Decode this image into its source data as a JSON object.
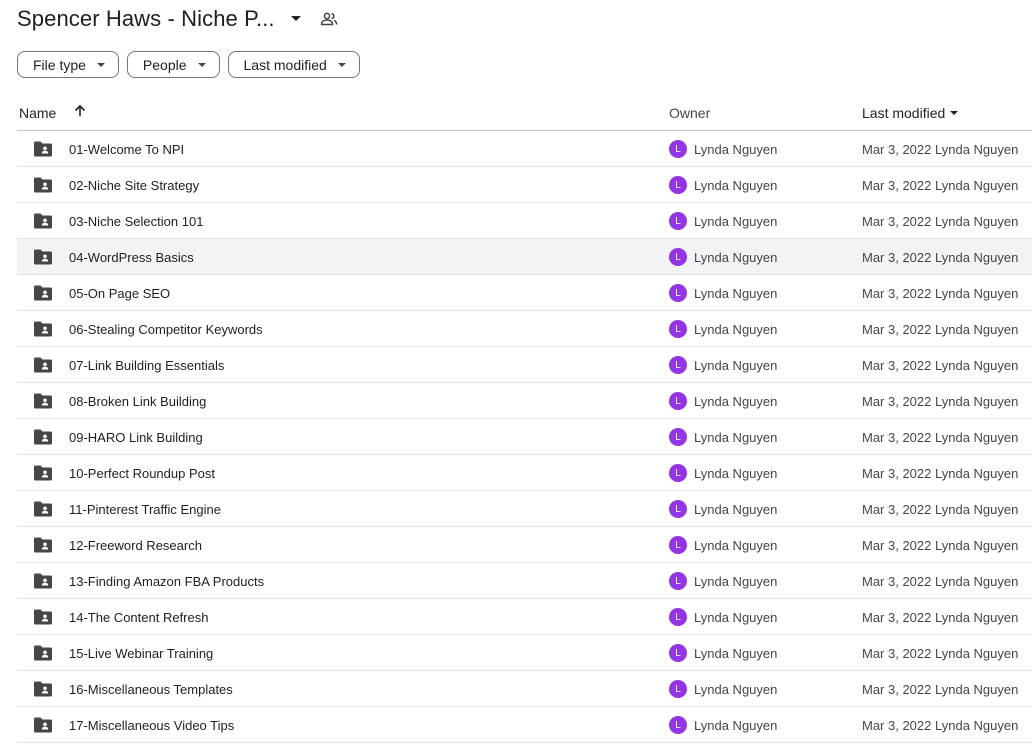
{
  "header": {
    "title": "Spencer Haws - Niche P...",
    "title_caret_icon": "arrow-drop-down-icon",
    "shared_icon": "people-icon"
  },
  "filters": {
    "file_type": "File type",
    "people": "People",
    "last_modified": "Last modified"
  },
  "table": {
    "columns": {
      "name": "Name",
      "owner": "Owner",
      "last_modified": "Last modified"
    },
    "sort_icon": "arrow-upward-icon",
    "rows": [
      {
        "name": "01-Welcome To NPI",
        "owner_initial": "L",
        "owner": "Lynda Nguyen",
        "modified": "Mar 3, 2022 Lynda Nguyen"
      },
      {
        "name": "02-Niche Site Strategy",
        "owner_initial": "L",
        "owner": "Lynda Nguyen",
        "modified": "Mar 3, 2022 Lynda Nguyen"
      },
      {
        "name": "03-Niche Selection 101",
        "owner_initial": "L",
        "owner": "Lynda Nguyen",
        "modified": "Mar 3, 2022 Lynda Nguyen"
      },
      {
        "name": "04-WordPress Basics",
        "owner_initial": "L",
        "owner": "Lynda Nguyen",
        "modified": "Mar 3, 2022 Lynda Nguyen"
      },
      {
        "name": "05-On Page SEO",
        "owner_initial": "L",
        "owner": "Lynda Nguyen",
        "modified": "Mar 3, 2022 Lynda Nguyen"
      },
      {
        "name": "06-Stealing Competitor Keywords",
        "owner_initial": "L",
        "owner": "Lynda Nguyen",
        "modified": "Mar 3, 2022 Lynda Nguyen"
      },
      {
        "name": "07-Link Building Essentials",
        "owner_initial": "L",
        "owner": "Lynda Nguyen",
        "modified": "Mar 3, 2022 Lynda Nguyen"
      },
      {
        "name": "08-Broken Link Building",
        "owner_initial": "L",
        "owner": "Lynda Nguyen",
        "modified": "Mar 3, 2022 Lynda Nguyen"
      },
      {
        "name": "09-HARO Link Building",
        "owner_initial": "L",
        "owner": "Lynda Nguyen",
        "modified": "Mar 3, 2022 Lynda Nguyen"
      },
      {
        "name": "10-Perfect Roundup Post",
        "owner_initial": "L",
        "owner": "Lynda Nguyen",
        "modified": "Mar 3, 2022 Lynda Nguyen"
      },
      {
        "name": "11-Pinterest Traffic Engine",
        "owner_initial": "L",
        "owner": "Lynda Nguyen",
        "modified": "Mar 3, 2022 Lynda Nguyen"
      },
      {
        "name": "12-Freeword Research",
        "owner_initial": "L",
        "owner": "Lynda Nguyen",
        "modified": "Mar 3, 2022 Lynda Nguyen"
      },
      {
        "name": "13-Finding Amazon FBA Products",
        "owner_initial": "L",
        "owner": "Lynda Nguyen",
        "modified": "Mar 3, 2022 Lynda Nguyen"
      },
      {
        "name": "14-The Content Refresh",
        "owner_initial": "L",
        "owner": "Lynda Nguyen",
        "modified": "Mar 3, 2022 Lynda Nguyen"
      },
      {
        "name": "15-Live Webinar Training",
        "owner_initial": "L",
        "owner": "Lynda Nguyen",
        "modified": "Mar 3, 2022 Lynda Nguyen"
      },
      {
        "name": "16-Miscellaneous Templates",
        "owner_initial": "L",
        "owner": "Lynda Nguyen",
        "modified": "Mar 3, 2022 Lynda Nguyen"
      },
      {
        "name": "17-Miscellaneous Video Tips",
        "owner_initial": "L",
        "owner": "Lynda Nguyen",
        "modified": "Mar 3, 2022 Lynda Nguyen"
      }
    ],
    "selected_row": 3,
    "folder_icon": "shared-folder-icon"
  },
  "colors": {
    "avatar": "#9334e6",
    "selected_row_bg": "#f1f3f4",
    "text": "#1f1f1f",
    "secondary_text": "#444746"
  }
}
